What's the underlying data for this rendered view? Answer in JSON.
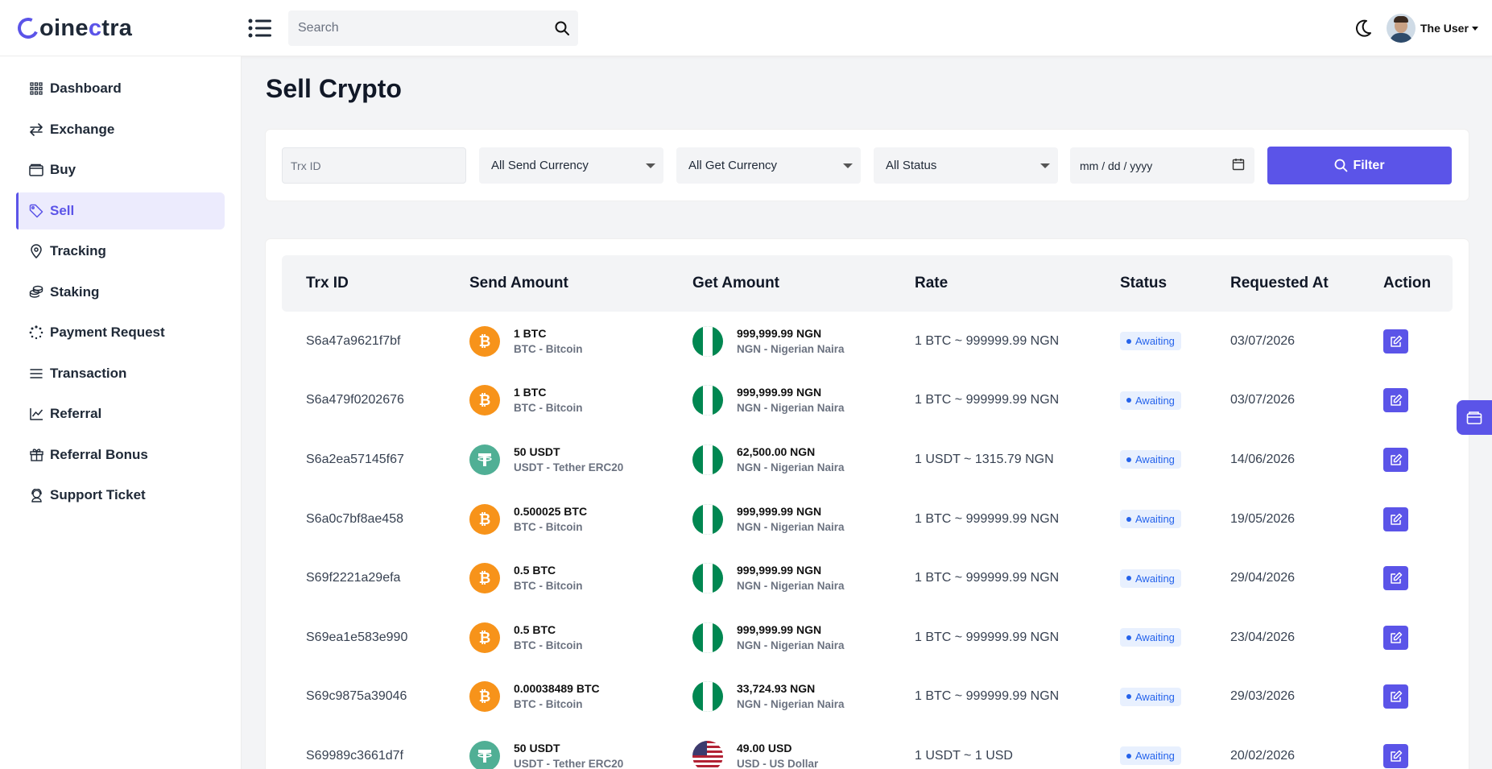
{
  "app": {
    "brand_start": "oine",
    "brand_accent": "c",
    "brand_end": "tra",
    "brand_color": "#5b54e8"
  },
  "header": {
    "search_placeholder": "Search",
    "user_name": "The User"
  },
  "sidebar": {
    "items": [
      {
        "label": "Dashboard",
        "icon": "grid-icon",
        "active": false
      },
      {
        "label": "Exchange",
        "icon": "exchange-icon",
        "active": false
      },
      {
        "label": "Buy",
        "icon": "wallet-icon",
        "active": false
      },
      {
        "label": "Sell",
        "icon": "tag-icon",
        "active": true
      },
      {
        "label": "Tracking",
        "icon": "map-pin-icon",
        "active": false
      },
      {
        "label": "Staking",
        "icon": "coins-icon",
        "active": false
      },
      {
        "label": "Payment Request",
        "icon": "spinner-icon",
        "active": false
      },
      {
        "label": "Transaction",
        "icon": "list-icon",
        "active": false
      },
      {
        "label": "Referral",
        "icon": "chart-icon",
        "active": false
      },
      {
        "label": "Referral Bonus",
        "icon": "gift-icon",
        "active": false
      },
      {
        "label": "Support Ticket",
        "icon": "support-icon",
        "active": false
      }
    ]
  },
  "page": {
    "title": "Sell Crypto"
  },
  "filters": {
    "trx_placeholder": "Trx ID",
    "send_currency": "All Send Currency",
    "get_currency": "All Get Currency",
    "status": "All Status",
    "date_placeholder": "mm / dd / yyyy",
    "filter_label": "Filter"
  },
  "table": {
    "headers": [
      "Trx ID",
      "Send Amount",
      "Get Amount",
      "Rate",
      "Status",
      "Requested At",
      "Action"
    ],
    "rows": [
      {
        "trx": "S6a47a9621f7bf",
        "send_amount": "1 BTC",
        "send_coin": "BTC - Bitcoin",
        "send_type": "btc",
        "get_amount": "999,999.99 NGN",
        "get_coin": "NGN - Nigerian Naira",
        "get_type": "ngn",
        "rate": "1 BTC ~ 999999.99 NGN",
        "status": "Awaiting",
        "date": "03/07/2026"
      },
      {
        "trx": "S6a479f0202676",
        "send_amount": "1 BTC",
        "send_coin": "BTC - Bitcoin",
        "send_type": "btc",
        "get_amount": "999,999.99 NGN",
        "get_coin": "NGN - Nigerian Naira",
        "get_type": "ngn",
        "rate": "1 BTC ~ 999999.99 NGN",
        "status": "Awaiting",
        "date": "03/07/2026"
      },
      {
        "trx": "S6a2ea57145f67",
        "send_amount": "50 USDT",
        "send_coin": "USDT - Tether ERC20",
        "send_type": "usdt",
        "get_amount": "62,500.00 NGN",
        "get_coin": "NGN - Nigerian Naira",
        "get_type": "ngn",
        "rate": "1 USDT ~ 1315.79 NGN",
        "status": "Awaiting",
        "date": "14/06/2026"
      },
      {
        "trx": "S6a0c7bf8ae458",
        "send_amount": "0.500025 BTC",
        "send_coin": "BTC - Bitcoin",
        "send_type": "btc",
        "get_amount": "999,999.99 NGN",
        "get_coin": "NGN - Nigerian Naira",
        "get_type": "ngn",
        "rate": "1 BTC ~ 999999.99 NGN",
        "status": "Awaiting",
        "date": "19/05/2026"
      },
      {
        "trx": "S69f2221a29efa",
        "send_amount": "0.5 BTC",
        "send_coin": "BTC - Bitcoin",
        "send_type": "btc",
        "get_amount": "999,999.99 NGN",
        "get_coin": "NGN - Nigerian Naira",
        "get_type": "ngn",
        "rate": "1 BTC ~ 999999.99 NGN",
        "status": "Awaiting",
        "date": "29/04/2026"
      },
      {
        "trx": "S69ea1e583e990",
        "send_amount": "0.5 BTC",
        "send_coin": "BTC - Bitcoin",
        "send_type": "btc",
        "get_amount": "999,999.99 NGN",
        "get_coin": "NGN - Nigerian Naira",
        "get_type": "ngn",
        "rate": "1 BTC ~ 999999.99 NGN",
        "status": "Awaiting",
        "date": "23/04/2026"
      },
      {
        "trx": "S69c9875a39046",
        "send_amount": "0.00038489 BTC",
        "send_coin": "BTC - Bitcoin",
        "send_type": "btc",
        "get_amount": "33,724.93 NGN",
        "get_coin": "NGN - Nigerian Naira",
        "get_type": "ngn",
        "rate": "1 BTC ~ 999999.99 NGN",
        "status": "Awaiting",
        "date": "29/03/2026"
      },
      {
        "trx": "S69989c3661d7f",
        "send_amount": "50 USDT",
        "send_coin": "USDT - Tether ERC20",
        "send_type": "usdt",
        "get_amount": "49.00 USD",
        "get_coin": "USD - US Dollar",
        "get_type": "usd",
        "rate": "1 USDT ~ 1 USD",
        "status": "Awaiting",
        "date": "20/02/2026"
      }
    ]
  },
  "colors": {
    "accent": "#5b54e8",
    "status_blue": "#2563eb",
    "btc": "#f7931a",
    "usdt": "#50af95",
    "ngn": "#008751"
  }
}
